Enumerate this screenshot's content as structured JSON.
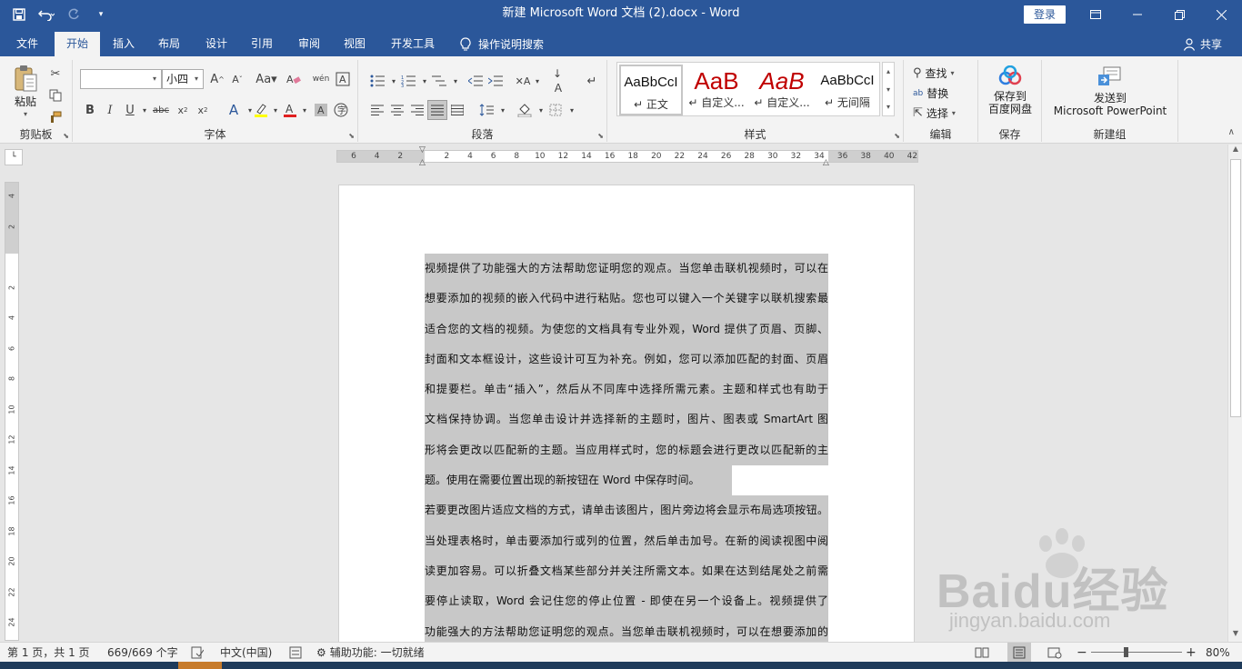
{
  "titlebar": {
    "title": "新建 Microsoft Word 文档 (2).docx  -  Word",
    "login": "登录",
    "qat": {
      "save": "save-icon",
      "undo": "undo-icon",
      "redo": "redo-icon",
      "customize": "customize-icon"
    }
  },
  "tabs": [
    "文件",
    "开始",
    "插入",
    "布局",
    "设计",
    "引用",
    "审阅",
    "视图",
    "开发工具"
  ],
  "active_tab": "开始",
  "tell_me": "操作说明搜索",
  "share": "共享",
  "ribbon": {
    "clipboard": {
      "paste": "粘贴",
      "label": "剪贴板"
    },
    "font": {
      "font_name": "",
      "font_size": "小四",
      "label": "字体"
    },
    "paragraph": {
      "label": "段落"
    },
    "styles": {
      "label": "样式",
      "items": [
        {
          "sample": "AaBbCcI",
          "name": "正文",
          "color": "#111111"
        },
        {
          "sample": "AaB",
          "name": "自定义...",
          "color": "#c00000"
        },
        {
          "sample": "AaB",
          "name": "自定义...",
          "color": "#c00000"
        },
        {
          "sample": "AaBbCcI",
          "name": "无间隔",
          "color": "#111111"
        }
      ]
    },
    "editing": {
      "find": "查找",
      "replace": "替换",
      "select": "选择",
      "label": "编辑"
    },
    "save": {
      "line1": "保存到",
      "line2": "百度网盘",
      "label": "保存"
    },
    "new_group": {
      "line1": "发送到",
      "line2": "Microsoft PowerPoint",
      "label": "新建组"
    }
  },
  "ruler": {
    "h_ticks": [
      "6",
      "4",
      "2",
      "",
      "2",
      "4",
      "6",
      "8",
      "10",
      "12",
      "14",
      "16",
      "18",
      "20",
      "22",
      "24",
      "26",
      "28",
      "30",
      "32",
      "34",
      "36",
      "38",
      "40",
      "42"
    ],
    "v_ticks": [
      "4",
      "2",
      "",
      "2",
      "4",
      "6",
      "8",
      "10",
      "12",
      "14",
      "16",
      "18",
      "20",
      "22",
      "24"
    ]
  },
  "document": {
    "lines": [
      "视频提供了功能强大的方法帮助您证明您的观点。当您单击联机视频时，可以在",
      "想要添加的视频的嵌入代码中进行粘贴。您也可以键入一个关键字以联机搜索最",
      "适合您的文档的视频。为使您的文档具有专业外观，Word 提供了页眉、页脚、",
      "封面和文本框设计，这些设计可互为补充。例如，您可以添加匹配的封面、页眉",
      "和提要栏。单击“插入”，然后从不同库中选择所需元素。主题和样式也有助于",
      "文档保持协调。当您单击设计并选择新的主题时，图片、图表或 SmartArt 图",
      "形将会更改以匹配新的主题。当应用样式时，您的标题会进行更改以匹配新的主",
      "题。使用在需要位置出现的新按钮在 Word 中保存时间。",
      "若要更改图片适应文档的方式，请单击该图片，图片旁边将会显示布局选项按钮。",
      "当处理表格时，单击要添加行或列的位置，然后单击加号。在新的阅读视图中阅",
      "读更加容易。可以折叠文档某些部分并关注所需文本。如果在达到结尾处之前需",
      "要停止读取，Word 会记住您的停止位置 - 即使在另一个设备上。视频提供了",
      "功能强大的方法帮助您证明您的观点。当您单击联机视频时，可以在想要添加的"
    ]
  },
  "status": {
    "page": "第 1 页，共 1 页",
    "words": "669/669 个字",
    "language": "中文(中国)",
    "accessibility": "辅助功能: 一切就绪",
    "zoom": "80%",
    "zoom_level": 0.8
  },
  "watermark": {
    "main": "Baidu经验",
    "sub": "jingyan.baidu.com"
  }
}
